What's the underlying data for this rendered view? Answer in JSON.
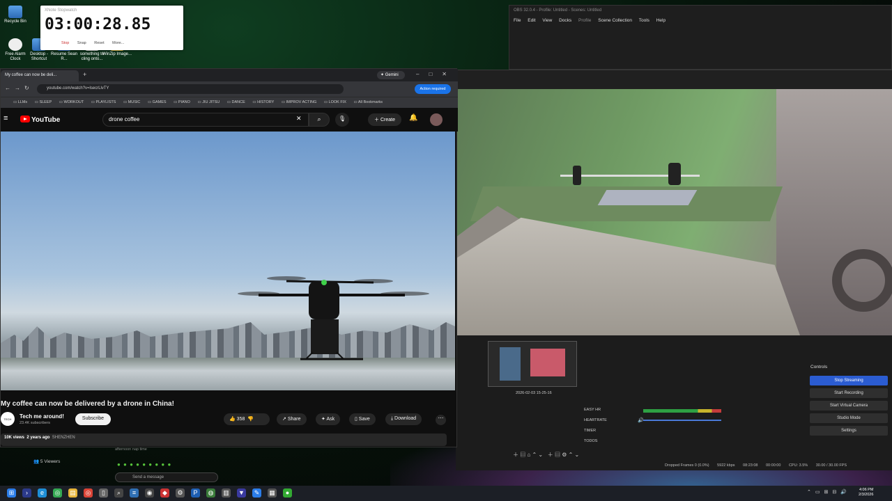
{
  "desktop": {
    "icons": [
      {
        "label": "Recycle Bin"
      },
      {
        "label": "Free Alarm Clock"
      },
      {
        "label": "Desktop - Shortcut"
      },
      {
        "label": "Resume Sean R..."
      },
      {
        "label": "something to cling onto..."
      },
      {
        "label": "WinZip Image..."
      }
    ]
  },
  "stopwatch": {
    "title": "XNote Stopwatch",
    "time": "03:00:28.85",
    "buttons": [
      "Stop",
      "Snap",
      "Reset",
      "More..."
    ]
  },
  "browser": {
    "tab_title": "My coffee can now be deli...",
    "gemini_label": "Gemini",
    "url": "youtube.com/watch?v=lsecrLlvTY",
    "action_required": "Action required",
    "bookmarks": [
      "LLMs",
      "SLEEP",
      "WORKOUT",
      "PLAYLISTS",
      "MUSIC",
      "GAMES",
      "PIANO",
      "JIU JITSU",
      "DANCE",
      "HISTORY",
      "IMPROV ACTING",
      "LOOK FIX"
    ],
    "all_bookmarks": "All Bookmarks"
  },
  "youtube": {
    "logo": "YouTube",
    "search_value": "drone coffee",
    "create_label": "Create",
    "video_title": "My coffee can now be delivered by a drone in China!",
    "channel_name": "Tech me around!",
    "subscribers": "23.4K subscribers",
    "subscribe_label": "Subscribe",
    "like_count": "358",
    "share_label": "Share",
    "ask_label": "Ask",
    "save_label": "Save",
    "download_label": "Download",
    "views": "10K views",
    "age": "2 years ago",
    "tag": "SHENZHEN"
  },
  "chat": {
    "note": "afternoon nap time",
    "viewers": "5 Viewers",
    "placeholder": "Send a message"
  },
  "obs": {
    "title": "OBS 32.0.4 - Profile: Untitled - Scenes: Untitled",
    "menu": [
      "File",
      "Edit",
      "View",
      "Docks",
      "Profile",
      "Scene Collection",
      "Tools",
      "Help"
    ],
    "preview_label": "2026-02-03 15-25-16",
    "sources": [
      "EASY HR",
      "HEARTRATE",
      "TIMER",
      "TODOS"
    ],
    "controls_title": "Controls",
    "controls": [
      "Stop Streaming",
      "Start Recording",
      "Start Virtual Camera",
      "Studio Mode",
      "Settings"
    ],
    "status": {
      "dropped": "Dropped Frames 0 (0.0%)",
      "bitrate": "5922 kbps",
      "stream_time": "08:23:08",
      "rec_time": "00:00:00",
      "cpu": "CPU: 3.5%",
      "fps": "30.00 / 30.00 FPS"
    }
  },
  "taskbar": {
    "time": "4:06 PM",
    "date": "2/3/2026"
  },
  "colors": {
    "youtube_red": "#ff0000",
    "obs_accent": "#2b5cd1",
    "chrome_blue": "#1a73e8"
  }
}
